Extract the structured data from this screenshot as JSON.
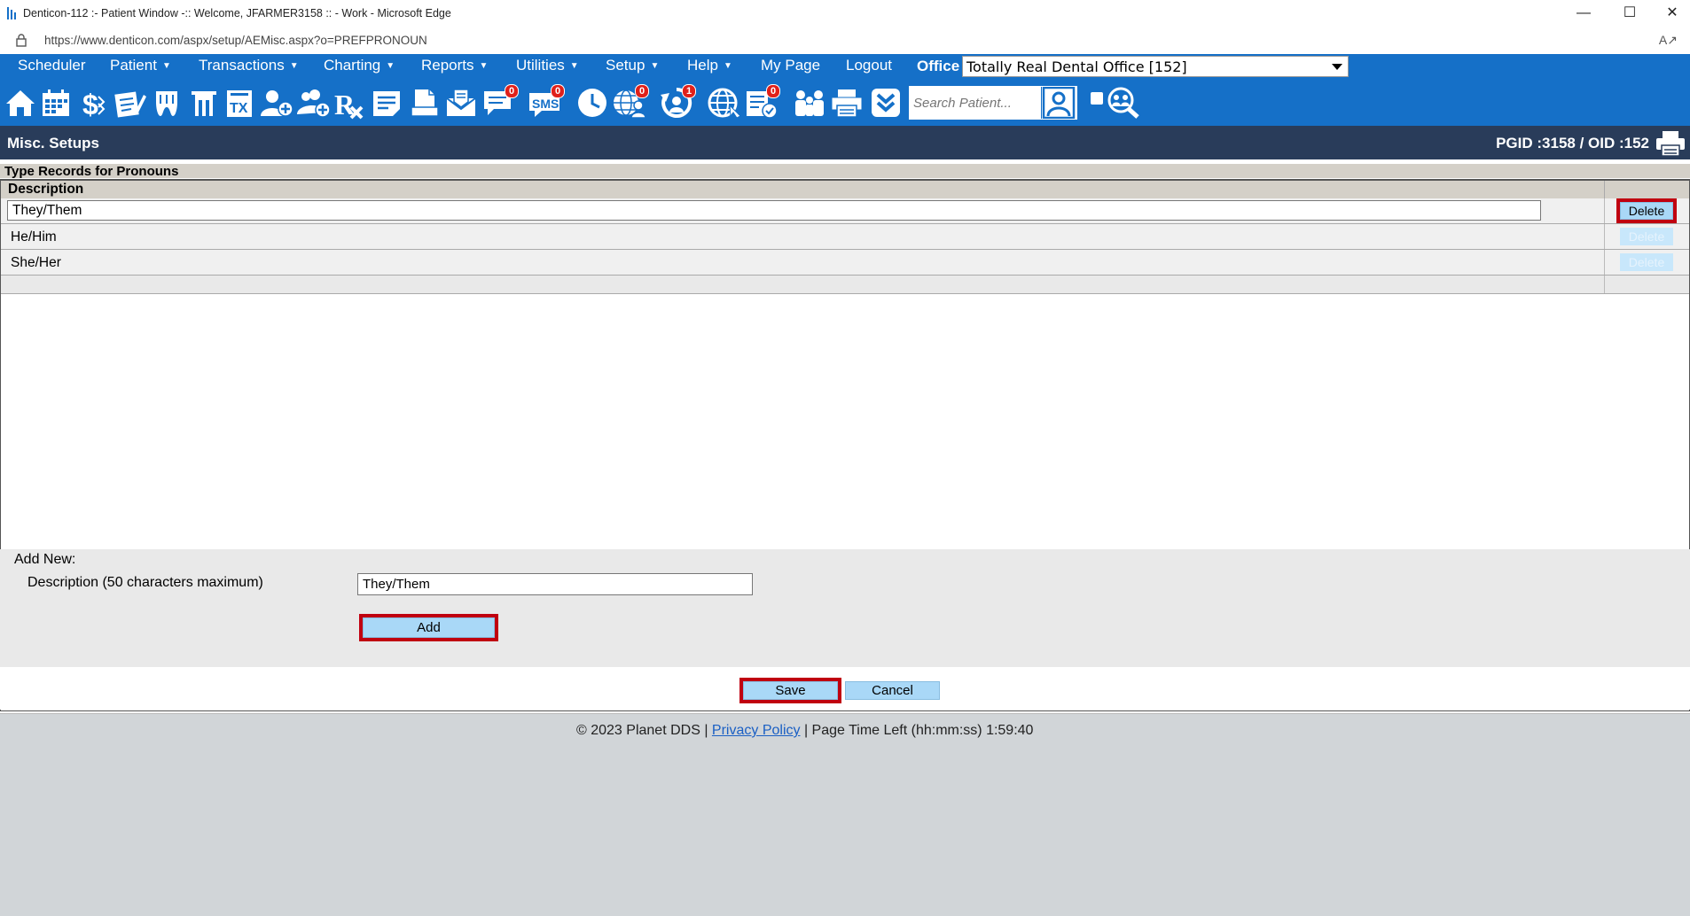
{
  "window": {
    "title": "Denticon-112 :- Patient Window -:: Welcome, JFARMER3158 :: - Work - Microsoft Edge",
    "url": "https://www.denticon.com/aspx/setup/AEMisc.aspx?o=PREFPRONOUN"
  },
  "menu": {
    "items": [
      {
        "label": "Scheduler",
        "caret": false
      },
      {
        "label": "Patient",
        "caret": true
      },
      {
        "label": "Transactions",
        "caret": true
      },
      {
        "label": "Charting",
        "caret": true
      },
      {
        "label": "Reports",
        "caret": true
      },
      {
        "label": "Utilities",
        "caret": true
      },
      {
        "label": "Setup",
        "caret": true
      },
      {
        "label": "Help",
        "caret": true
      },
      {
        "label": "My Page",
        "caret": false
      },
      {
        "label": "Logout",
        "caret": false
      }
    ],
    "office_label": "Office",
    "office_value": "Totally Real Dental Office [152]"
  },
  "toolbar": {
    "icons": [
      "home-icon",
      "calendar-icon",
      "dollar-icon",
      "ledger-pen-icon",
      "tooth-icon",
      "teeth-chart-icon",
      "tx-icon",
      "add-patient-icon",
      "add-family-icon",
      "rx-icon",
      "notes-icon",
      "document-icon",
      "mail-icon",
      "messages-icon",
      "sms-icon",
      "clock-icon",
      "web-users-icon",
      "recall-icon",
      "globe-icon",
      "forms-icon",
      "family-icon",
      "printer-icon",
      "dropdown-icon"
    ],
    "badges": {
      "messages": "0",
      "sms": "0",
      "web_users": "0",
      "recall": "1",
      "forms": "0"
    },
    "search_placeholder": "Search Patient..."
  },
  "header": {
    "title": "Misc. Setups",
    "ids": "PGID :3158  /  OID :152"
  },
  "records": {
    "title": "Type Records for Pronouns",
    "column_header": "Description",
    "rows": [
      {
        "description": "They/Them",
        "editing": true,
        "delete_label": "Delete"
      },
      {
        "description": "He/Him",
        "editing": false,
        "delete_label": "Delete"
      },
      {
        "description": "She/Her",
        "editing": false,
        "delete_label": "Delete"
      }
    ]
  },
  "add_new": {
    "label": "Add New:",
    "description_label": "Description (50 characters maximum)",
    "description_value": "They/Them",
    "add_label": "Add"
  },
  "actions": {
    "save_label": "Save",
    "cancel_label": "Cancel"
  },
  "footer": {
    "copyright": "© 2023 Planet DDS |",
    "privacy_label": "Privacy Policy",
    "time_left": "|  Page Time Left (hh:mm:ss) 1:59:40"
  },
  "colors": {
    "menu_blue": "#1570c8",
    "header_navy": "#293c5a",
    "button_blue": "#a9d8f7",
    "highlight_red": "#c00010"
  }
}
